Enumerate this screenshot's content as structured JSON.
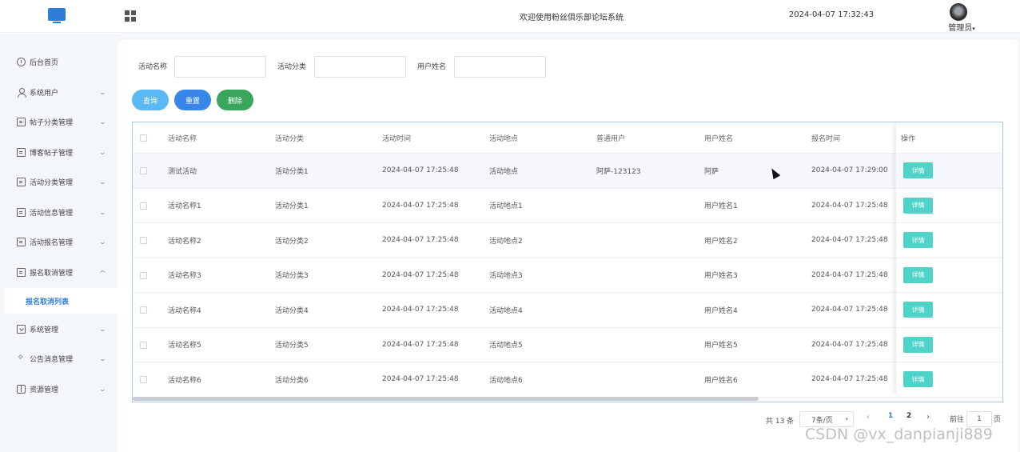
{
  "header": {
    "site_title": "欢迎使用粉丝俱乐部论坛系统",
    "datetime": "2024-04-07 17:32:43",
    "user_label": "管理员"
  },
  "sidebar": {
    "items": [
      {
        "label": "后台首页",
        "icon": "clock-icon"
      },
      {
        "label": "系统用户",
        "icon": "user-icon",
        "expand": "down"
      },
      {
        "label": "帖子分类管理",
        "icon": "card-icon",
        "expand": "down"
      },
      {
        "label": "博客帖子管理",
        "icon": "card-icon",
        "expand": "down"
      },
      {
        "label": "活动分类管理",
        "icon": "card-icon",
        "expand": "down"
      },
      {
        "label": "活动信息管理",
        "icon": "card-icon",
        "expand": "down"
      },
      {
        "label": "活动报名管理",
        "icon": "card-icon",
        "expand": "down"
      },
      {
        "label": "报名取消管理",
        "icon": "card-icon",
        "expand": "up"
      },
      {
        "label": "系统管理",
        "icon": "folder-icon",
        "expand": "down"
      },
      {
        "label": "公告消息管理",
        "icon": "bell-icon",
        "expand": "down"
      },
      {
        "label": "资源管理",
        "icon": "gift-icon",
        "expand": "down"
      }
    ],
    "active_subitem": "报名取消列表"
  },
  "search": {
    "fields": [
      {
        "label": "活动名称",
        "value": ""
      },
      {
        "label": "活动分类",
        "value": ""
      },
      {
        "label": "用户姓名",
        "value": ""
      }
    ],
    "query_label": "查询",
    "reset_label": "重置",
    "delete_label": "删除"
  },
  "table": {
    "columns": [
      "活动名称",
      "活动分类",
      "活动时间",
      "活动地点",
      "普通用户",
      "用户姓名",
      "报名时间",
      "操作"
    ],
    "rows": [
      [
        "测试活动",
        "活动分类1",
        "2024-04-07 17:25:48",
        "活动地点",
        "阿萨-123123",
        "阿萨",
        "2024-04-07 17:29:00"
      ],
      [
        "活动名称1",
        "活动分类1",
        "2024-04-07 17:25:48",
        "活动地点1",
        "",
        "用户姓名1",
        "2024-04-07 17:25:48"
      ],
      [
        "活动名称2",
        "活动分类2",
        "2024-04-07 17:25:48",
        "活动地点2",
        "",
        "用户姓名2",
        "2024-04-07 17:25:48"
      ],
      [
        "活动名称3",
        "活动分类3",
        "2024-04-07 17:25:48",
        "活动地点3",
        "",
        "用户姓名3",
        "2024-04-07 17:25:48"
      ],
      [
        "活动名称4",
        "活动分类4",
        "2024-04-07 17:25:48",
        "活动地点4",
        "",
        "用户姓名4",
        "2024-04-07 17:25:48"
      ],
      [
        "活动名称5",
        "活动分类5",
        "2024-04-07 17:25:48",
        "活动地点5",
        "",
        "用户姓名5",
        "2024-04-07 17:25:48"
      ],
      [
        "活动名称6",
        "活动分类6",
        "2024-04-07 17:25:48",
        "活动地点6",
        "",
        "用户姓名6",
        "2024-04-07 17:25:48"
      ]
    ],
    "detail_label": "详情"
  },
  "pagination": {
    "total": "共 13 条",
    "page_size": "7条/页",
    "pages": [
      "1",
      "2"
    ],
    "current_page": "1",
    "goto_label": "前往",
    "goto_value": "1",
    "page_suffix": "页"
  },
  "watermark": "CSDN @vx_danpianji889",
  "colors": {
    "primary": "#2f7dd6",
    "query": "#5ab8f2",
    "reset": "#3a86e8",
    "delete": "#3aa55c",
    "detail": "#4fd3c9",
    "sidebar_bg": "#f3f6fa"
  }
}
